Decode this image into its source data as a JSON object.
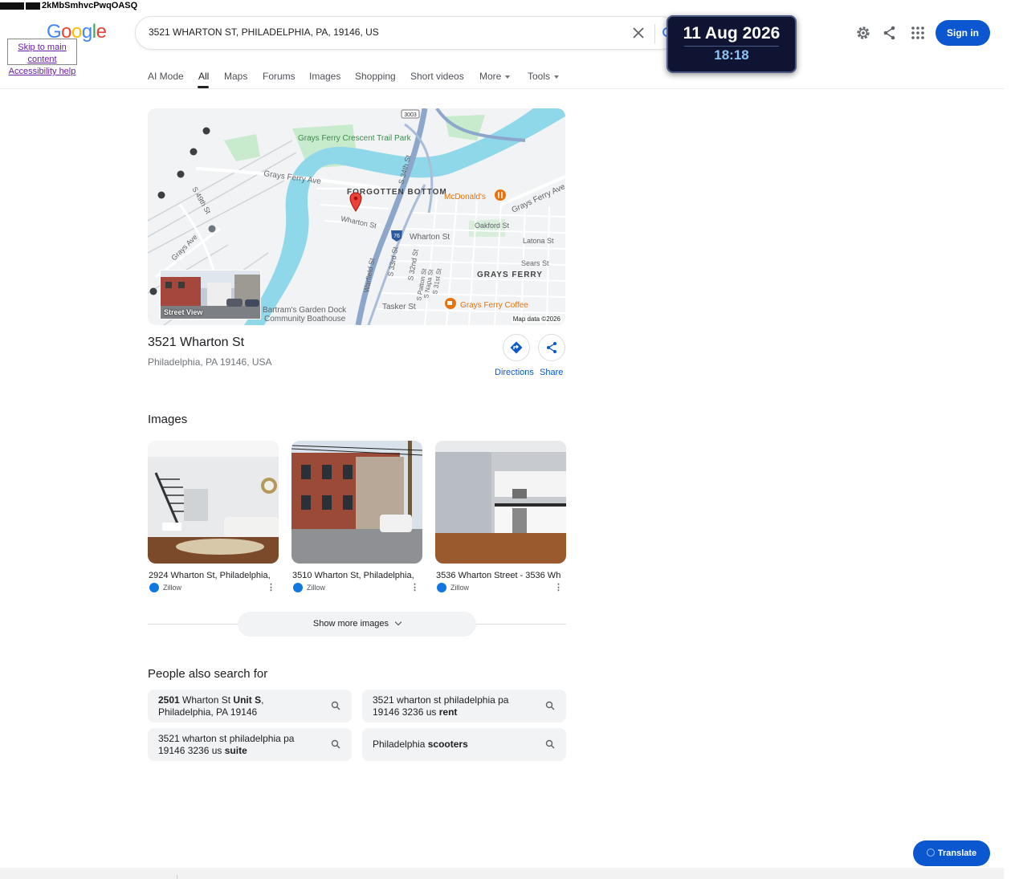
{
  "overlay": {
    "glitch_text": "2kMbSmhvcPwqOASQ",
    "skip_links": [
      "Skip to main content",
      "Accessibility help"
    ]
  },
  "logo": {
    "letters": [
      "G",
      "o",
      "o",
      "g",
      "l",
      "e"
    ]
  },
  "search": {
    "query": "3521 WHARTON ST, PHILADELPHIA, PA, 19146, US"
  },
  "clock": {
    "date": "11 Aug 2026",
    "time": "18:18"
  },
  "header": {
    "sign_in": "Sign in"
  },
  "tabs": [
    {
      "label": "AI Mode"
    },
    {
      "label": "All"
    },
    {
      "label": "Maps"
    },
    {
      "label": "Forums"
    },
    {
      "label": "Images"
    },
    {
      "label": "Shopping"
    },
    {
      "label": "Short videos"
    },
    {
      "label": "More"
    },
    {
      "label": "Tools"
    }
  ],
  "map": {
    "street_view_label": "Street View",
    "attribution": "Map data ©2026",
    "labels": {
      "park": "Grays Ferry Crescent Trail Park",
      "grays_ferry_ave_w": "Grays Ferry Ave",
      "grays_ferry_ave_e": "Grays Ferry Ave",
      "forgotten_bottom": "FORGOTTEN BOTTOM",
      "wharton_st_w": "Wharton St",
      "wharton_st_e": "Wharton St",
      "mcdonalds": "McDonald's",
      "oakford": "Oakford St",
      "latona": "Latona St",
      "sears": "Sears St",
      "grays_ferry": "GRAYS FERRY",
      "s34th": "S 34th St",
      "s49th": "S 49th St",
      "grays_ave": "Grays Ave",
      "warfield": "Warfield St",
      "s33rd": "S 33rd St",
      "s32nd": "S 32nd St",
      "patton": "S Patton St",
      "napa": "S Napa St",
      "s31st": "S 31st St",
      "tasker": "Tasker St",
      "coffee": "Grays Ferry Coffee",
      "dock": "Bartram's Garden Dock",
      "boathouse": "Community Boathouse",
      "route": "3003",
      "interstate": "76"
    }
  },
  "place": {
    "title": "3521 Wharton St",
    "subtitle": "Philadelphia, PA 19146, USA",
    "directions": "Directions",
    "share": "Share"
  },
  "images": {
    "heading": "Images",
    "items": [
      {
        "caption": "2924 Wharton St, Philadelphia,",
        "source": "Zillow"
      },
      {
        "caption": "3510 Wharton St, Philadelphia,",
        "source": "Zillow"
      },
      {
        "caption": "3536 Wharton Street - 3536 Wh",
        "source": "Zillow"
      }
    ],
    "show_more": "Show more images"
  },
  "people_also_search": {
    "heading": "People also search for",
    "items": [
      {
        "parts": [
          [
            "2501",
            true
          ],
          [
            " Wharton St ",
            false
          ],
          [
            "Unit S",
            true
          ],
          [
            ",",
            false
          ],
          [
            "Philadelphia, PA 19146",
            false
          ]
        ]
      },
      {
        "parts": [
          [
            "3521 wharton st philadelphia pa 19146 3236 us ",
            false
          ],
          [
            "rent",
            true
          ]
        ]
      },
      {
        "parts": [
          [
            "3521 wharton st philadelphia pa 19146 3236 us ",
            false
          ],
          [
            "suite",
            true
          ]
        ]
      },
      {
        "parts": [
          [
            "Philadelphia ",
            false
          ],
          [
            "scooters",
            true
          ]
        ]
      }
    ]
  },
  "translate": {
    "label": "Translate"
  },
  "colors": {
    "primary": "#0b57d0",
    "river": "#8fd8ea",
    "highway": "#8ca6cc",
    "park": "#c8eacd",
    "poi": "#e8710a"
  }
}
